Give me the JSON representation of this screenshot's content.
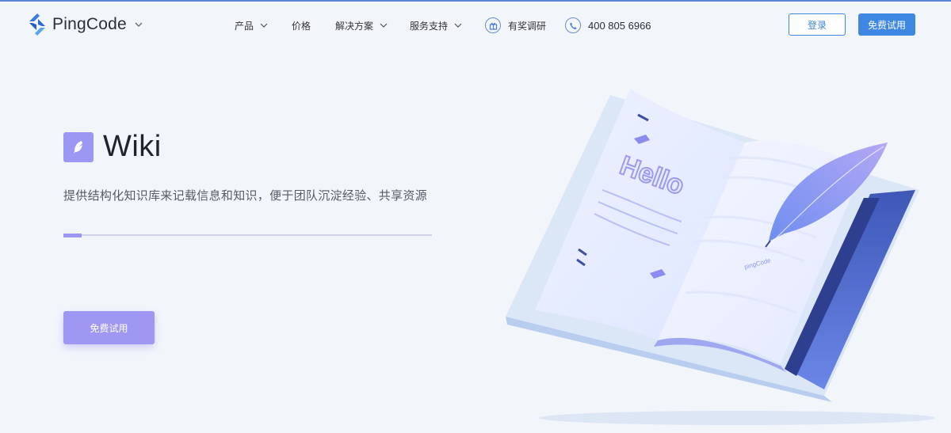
{
  "brand": {
    "name": "PingCode",
    "colors": {
      "accent": "#3e87e2",
      "wiki": "#9d97f4"
    }
  },
  "nav": {
    "items": [
      {
        "label": "产品",
        "has_dropdown": true
      },
      {
        "label": "价格",
        "has_dropdown": false
      },
      {
        "label": "解决方案",
        "has_dropdown": true
      },
      {
        "label": "服务支持",
        "has_dropdown": true
      }
    ],
    "survey_label": "有奖调研",
    "phone": "400 805 6966"
  },
  "header": {
    "login_label": "登录",
    "trial_label": "免费试用"
  },
  "hero": {
    "title": "Wiki",
    "subtitle": "提供结构化知识库来记载信息和知识，便于团队沉淀经验、共享资源",
    "progress": 0.05,
    "cta_label": "免费试用"
  },
  "illustration": {
    "page_text": "Hello",
    "brand_mark": "pingCode"
  },
  "icons": [
    "pingcode-logo-icon",
    "chevron-down-icon",
    "gift-icon",
    "phone-icon",
    "wiki-feather-icon"
  ]
}
